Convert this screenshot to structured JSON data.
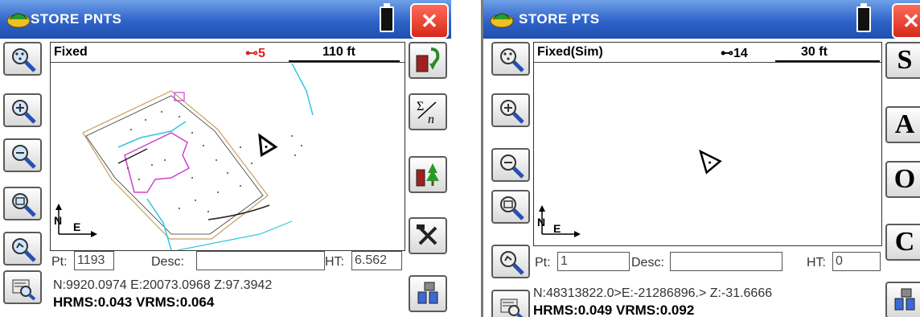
{
  "left": {
    "title": "STORE PNTS",
    "close_label": "✕",
    "status": {
      "mode": "Fixed",
      "satellites": "⊷5",
      "scale": "110 ft"
    },
    "compass": {
      "north": "N",
      "east": "E"
    },
    "point_label": "Pt:",
    "point_value": "1193",
    "desc_label": "Desc:",
    "desc_value": "",
    "ht_label": "HT:",
    "ht_value": "6.562",
    "coords_line": "N:9920.0974   E:20073.0968   Z:97.3942",
    "rms_line": "HRMS:0.043 VRMS:0.064",
    "right_tools": [
      "store-download-icon",
      "sum-n-icon",
      "offset-survey-icon",
      "tools-icon",
      "gps-satellite-icon"
    ]
  },
  "right": {
    "title": "STORE PTS",
    "close_label": "✕",
    "status": {
      "mode": "Fixed(Sim)",
      "satellites": "⊷14",
      "scale": "30 ft"
    },
    "compass": {
      "north": "N",
      "east": "E"
    },
    "point_label": "Pt:",
    "point_value": "1",
    "desc_label": "Desc:",
    "desc_value": "",
    "ht_label": "HT:",
    "ht_value": "0",
    "coords_line": "N:48313822.0>E:-21286896.> Z:-31.6666",
    "rms_line": "HRMS:0.049 VRMS:0.092",
    "right_tools": [
      "S",
      "A",
      "O",
      "C"
    ]
  },
  "left_tools": [
    "zoom-extents-icon",
    "zoom-in-icon",
    "zoom-out-icon",
    "zoom-window-icon",
    "zoom-previous-icon",
    "map-view-icon"
  ],
  "colors": {
    "titlebar": "#2f63c8",
    "close": "#d62a1a",
    "magenta": "#d040d0",
    "cyan": "#30c8e0",
    "tan": "#c8a060"
  }
}
